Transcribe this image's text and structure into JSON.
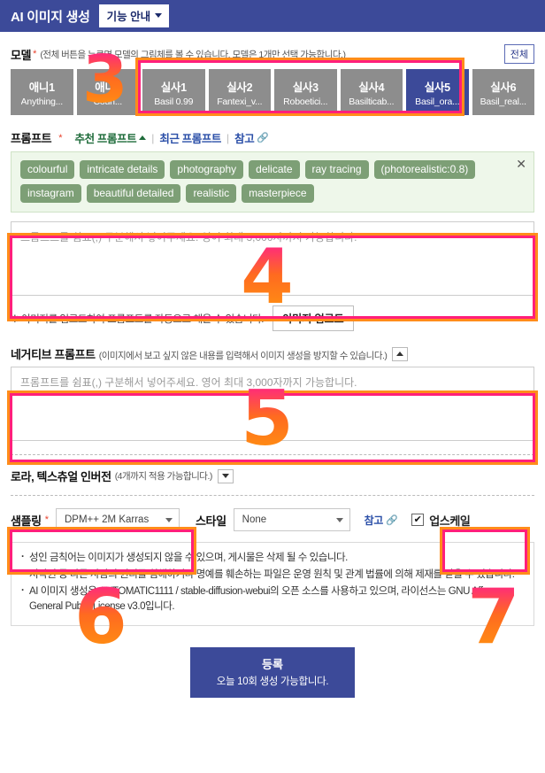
{
  "header": {
    "title": "AI 이미지 생성",
    "guide_button": "기능 안내"
  },
  "model_section": {
    "label": "모델",
    "required_mark": "*",
    "hint": "(전체 버튼을 누르면 모델의 그림체를 볼 수 있습니다. 모델은 1개만 선택 가능합니다.)",
    "all_button": "전체",
    "models": [
      {
        "name": "애니1",
        "file": "Anything...",
        "selected": false
      },
      {
        "name": "애니2",
        "file": "Coun...",
        "selected": false
      },
      {
        "name": "실사1",
        "file": "Basil 0.99",
        "selected": false
      },
      {
        "name": "실사2",
        "file": "Fantexi_v...",
        "selected": false
      },
      {
        "name": "실사3",
        "file": "Roboetici...",
        "selected": false
      },
      {
        "name": "실사4",
        "file": "Basilticab...",
        "selected": false
      },
      {
        "name": "실사5",
        "file": "Basil_ora...",
        "selected": true
      },
      {
        "name": "실사6",
        "file": "Basil_real...",
        "selected": false
      }
    ]
  },
  "prompt_section": {
    "label": "프롬프트",
    "required_mark": "*",
    "recommended_link": "추천 프롬프트",
    "recent_link": "최근 프롬프트",
    "reference_link": "참고",
    "separator": "|",
    "close_icon": "✕",
    "tags": [
      "colourful",
      "intricate details",
      "photography",
      "delicate",
      "ray tracing",
      "(photorealistic:0.8)",
      "instagram",
      "beautiful detailed",
      "realistic",
      "masterpiece"
    ],
    "textarea_value": "",
    "textarea_placeholder": "프롬프트를 쉼표(,) 구분해서 넣어주세요. 영어 최대 3,000자까지 가능합니다.",
    "upload_note": "※ 이미지를 업로드하여 프롬프트를 자동으로 채울 수 있습니다.",
    "upload_button": "이미지 업로드"
  },
  "negative_section": {
    "label": "네거티브 프롬프트",
    "hint": "(이미지에서 보고 싶지 않은 내용를 입력해서 이미지 생성을 방지할 수 있습니다.)",
    "textarea_value": "",
    "textarea_placeholder": "프롬프트를 쉼표(,) 구분해서 넣어주세요. 영어 최대 3,000자까지 가능합니다."
  },
  "lora_section": {
    "label": "로라, 텍스츄얼 인버전",
    "hint": "(4개까지 적용 가능합니다.)"
  },
  "sampling_section": {
    "sampling_label": "샘플링",
    "required_mark": "*",
    "sampling_value": "DPM++ 2M Karras",
    "style_label": "스타일",
    "style_value": "None",
    "reference_link": "참고",
    "upscale_label": "업스케일",
    "upscale_checked": true,
    "check_mark": "✔"
  },
  "notice": {
    "lines": [
      "성인 금칙어는 이미지가 생성되지 않을 수 있으며, 게시물은 삭제 될 수 있습니다.",
      "저작권 등 다른 사람의 권리를 침해하거나 명예를 훼손하는 파일은 운영 원칙 및 관계 법률에 의해 제재를 받을 수 있습니다.",
      "AI 이미지 생성은 AUTOMATIC1111 / stable-diffusion-webui의 오픈 소스를 사용하고 있으며, 라이선스는 GNU Affero General Public License v3.0입니다."
    ]
  },
  "submit": {
    "main_label": "등록",
    "sub_label": "오늘 10회 생성 가능합니다."
  },
  "annotations": {
    "numbers": [
      "3",
      "4",
      "5",
      "6",
      "7"
    ]
  },
  "colors": {
    "brand_navy": "#3c4a99",
    "tag_green": "#7d9f76",
    "tag_panel_bg": "#eef7ea",
    "model_grey": "#8d8d8d",
    "annotation_pink": "#ff1f7a",
    "annotation_orange": "#ff8c1a"
  }
}
